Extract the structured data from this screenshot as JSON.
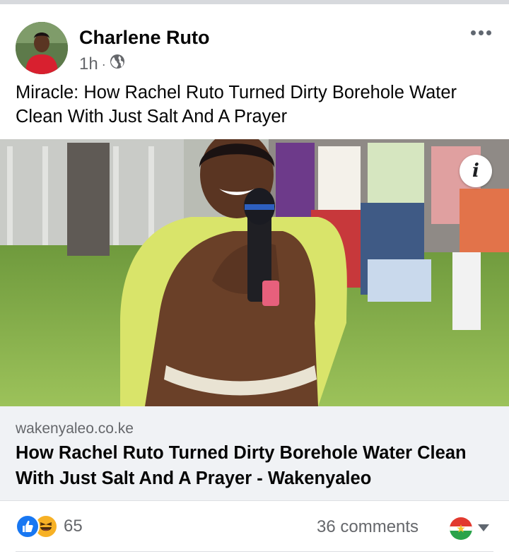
{
  "post": {
    "author": "Charlene Ruto",
    "time": "1h",
    "separator": "·",
    "privacy_icon": "globe-icon",
    "caption": "Miracle: How Rachel Ruto Turned Dirty Borehole Water Clean With Just Salt And A Prayer"
  },
  "link_preview": {
    "domain": "wakenyaleo.co.ke",
    "title": "How Rachel Ruto Turned Dirty Borehole Water Clean With Just Salt And A Prayer - Wakenyaleo",
    "info_label": "i"
  },
  "engagement": {
    "reaction_count": "65",
    "reactions": [
      "like",
      "haha"
    ],
    "comments": "36 comments"
  },
  "colors": {
    "accent": "#1877f2",
    "secondary_text": "#65676b",
    "card_bg": "#f0f2f5"
  }
}
